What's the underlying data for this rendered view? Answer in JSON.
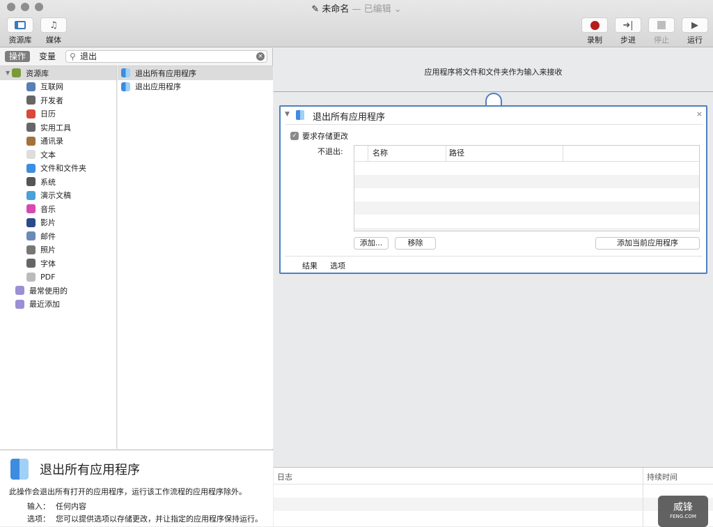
{
  "window": {
    "title": "未命名",
    "separator": "—",
    "status": "已编辑"
  },
  "toolbar": {
    "library": "资源库",
    "media": "媒体",
    "record": "录制",
    "step": "步进",
    "stop": "停止",
    "run": "运行"
  },
  "left": {
    "tab_actions": "操作",
    "tab_variables": "变量",
    "search_value": "退出",
    "categories": [
      {
        "label": "资源库",
        "color": "#7a9a3a"
      },
      {
        "label": "互联网",
        "color": "#5a7fb5"
      },
      {
        "label": "开发者",
        "color": "#666"
      },
      {
        "label": "日历",
        "color": "#d9493a"
      },
      {
        "label": "实用工具",
        "color": "#666"
      },
      {
        "label": "通讯录",
        "color": "#a5713b"
      },
      {
        "label": "文本",
        "color": "#ddd"
      },
      {
        "label": "文件和文件夹",
        "color": "#3c8ee0"
      },
      {
        "label": "系统",
        "color": "#555"
      },
      {
        "label": "演示文稿",
        "color": "#4aa0d8"
      },
      {
        "label": "音乐",
        "color": "#d84ab0"
      },
      {
        "label": "影片",
        "color": "#2a4a8a"
      },
      {
        "label": "邮件",
        "color": "#6a8ab8"
      },
      {
        "label": "照片",
        "color": "#777"
      },
      {
        "label": "字体",
        "color": "#666"
      },
      {
        "label": "PDF",
        "color": "#bbb"
      },
      {
        "label": "最常使用的",
        "color": "#9b8fd6"
      },
      {
        "label": "最近添加",
        "color": "#9b8fd6"
      }
    ],
    "actions": [
      "退出所有应用程序",
      "退出应用程序"
    ],
    "description": {
      "title": "退出所有应用程序",
      "text": "此操作会退出所有打开的应用程序，运行该工作流程的应用程序除外。",
      "input_label": "输入：",
      "input_value": "任何内容",
      "options_label": "选项：",
      "options_value": "您可以提供选项以存储更改，并让指定的应用程序保持运行。"
    }
  },
  "workflow": {
    "header": "应用程序将文件和文件夹作为输入来接收",
    "card": {
      "title": "退出所有应用程序",
      "checkbox_label": "要求存储更改",
      "checked": true,
      "dont_quit_label": "不退出:",
      "columns": [
        "名称",
        "路径"
      ],
      "add": "添加...",
      "remove": "移除",
      "add_current": "添加当前应用程序",
      "tab_results": "结果",
      "tab_options": "选项"
    }
  },
  "log": {
    "col_log": "日志",
    "col_duration": "持续时间"
  },
  "watermark": "威锋 FENG.COM"
}
